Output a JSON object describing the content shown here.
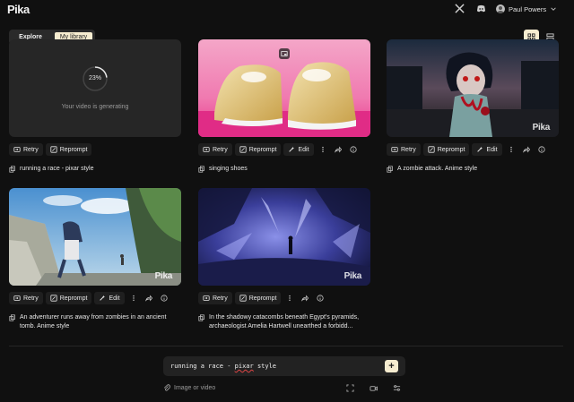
{
  "app": {
    "logo": "Pika"
  },
  "header": {
    "user_name": "Paul Powers"
  },
  "tabs": [
    {
      "label": "Explore"
    },
    {
      "label": "My library"
    }
  ],
  "generating": {
    "percent_label": "23%",
    "progress": 0.23,
    "message": "Your video is generating"
  },
  "actions": {
    "retry": "Retry",
    "reprompt": "Reprompt",
    "edit": "Edit"
  },
  "cards": [
    {
      "caption": "running a race - pixar style"
    },
    {
      "caption": "singing shoes",
      "watermark": ""
    },
    {
      "caption": "A zombie attack. Anime style",
      "watermark": "Pika"
    },
    {
      "caption": "An adventurer runs away from zombies in an ancient tomb. Anime style",
      "watermark": "Pika"
    },
    {
      "caption": "In the shadowy catacombs beneath Egypt's pyramids, archaeologist Amelia Hartwell unearthed a forbidd...",
      "watermark": "Pika"
    }
  ],
  "prompt": {
    "value_prefix": "running a race - ",
    "value_underlined": "pixar",
    "value_suffix": " style",
    "send_label": "+"
  },
  "attach": {
    "label": "Image or video"
  },
  "colors": {
    "accent": "#f6ecd0",
    "background": "#101010",
    "panel": "#262626"
  }
}
